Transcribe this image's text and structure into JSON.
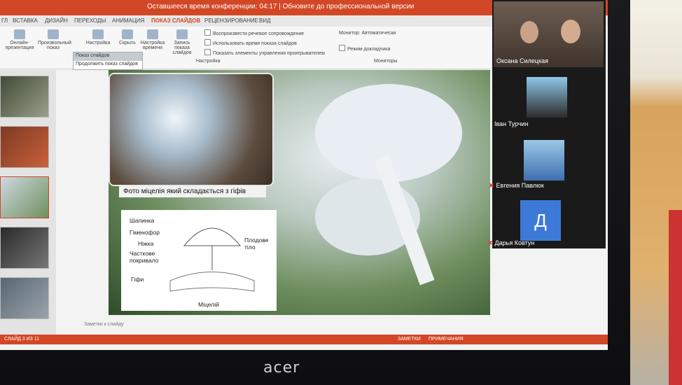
{
  "titlebar": {
    "text": "Оставшееся время конференции: 04:17 | Обновите до профессиональной версии"
  },
  "ribbon": {
    "tabs": [
      "ГЛ",
      "ВСТАВКА",
      "ДИЗАЙН",
      "ПЕРЕХОДЫ",
      "АНИМАЦИЯ",
      "ПОКАЗ СЛАЙДОВ",
      "РЕЦЕНЗИРОВАНИЕ",
      "ВИД"
    ],
    "buttons": [
      {
        "label": "Онлайн-презентация"
      },
      {
        "label": "Произвольный показ"
      },
      {
        "label": "Настройка"
      },
      {
        "label": "Скрыть"
      },
      {
        "label": "Настройка времени"
      },
      {
        "label": "Запись показа слайдов"
      }
    ],
    "options": [
      "Воспроизвести речевое сопровождение",
      "Использовать время показа слайдов",
      "Показать элементы управления проигрывателем"
    ],
    "group_setup": "Настройка",
    "monitor_label": "Монитор: Автоматически",
    "presenter_view": "Режим докладчика",
    "group_monitors": "Мониторы",
    "dropdown": [
      "Показ слайдов",
      "Продолжить показ слайдов"
    ]
  },
  "slide": {
    "caption": "Фото міцелія який складається з гіфів",
    "diagram_labels": {
      "cap": "Шапинка",
      "hymenophore": "Гіменофор",
      "stem": "Ніжка",
      "veil": "Часткове покривало",
      "hyphae": "Гіфи",
      "fruit_body": "Плодове тіло",
      "mycelium": "Міцелій"
    },
    "notes_placeholder": "Заметки к слайду"
  },
  "status": {
    "left": "СЛАЙД 3 ИЗ 11",
    "notes": "ЗАМЕТКИ",
    "comments": "ПРИМЕЧАНИЯ"
  },
  "participants": [
    {
      "name": "Оксана Силецкая"
    },
    {
      "name": "Іван Турчин"
    },
    {
      "name": "Евгения Павлюк"
    },
    {
      "name": "Дарья Ковтун",
      "initial": "Д"
    }
  ],
  "laptop": {
    "brand": "acer"
  },
  "colors": {
    "ribbon_accent": "#d24726",
    "avatar_bg": "#3d7ad8"
  }
}
